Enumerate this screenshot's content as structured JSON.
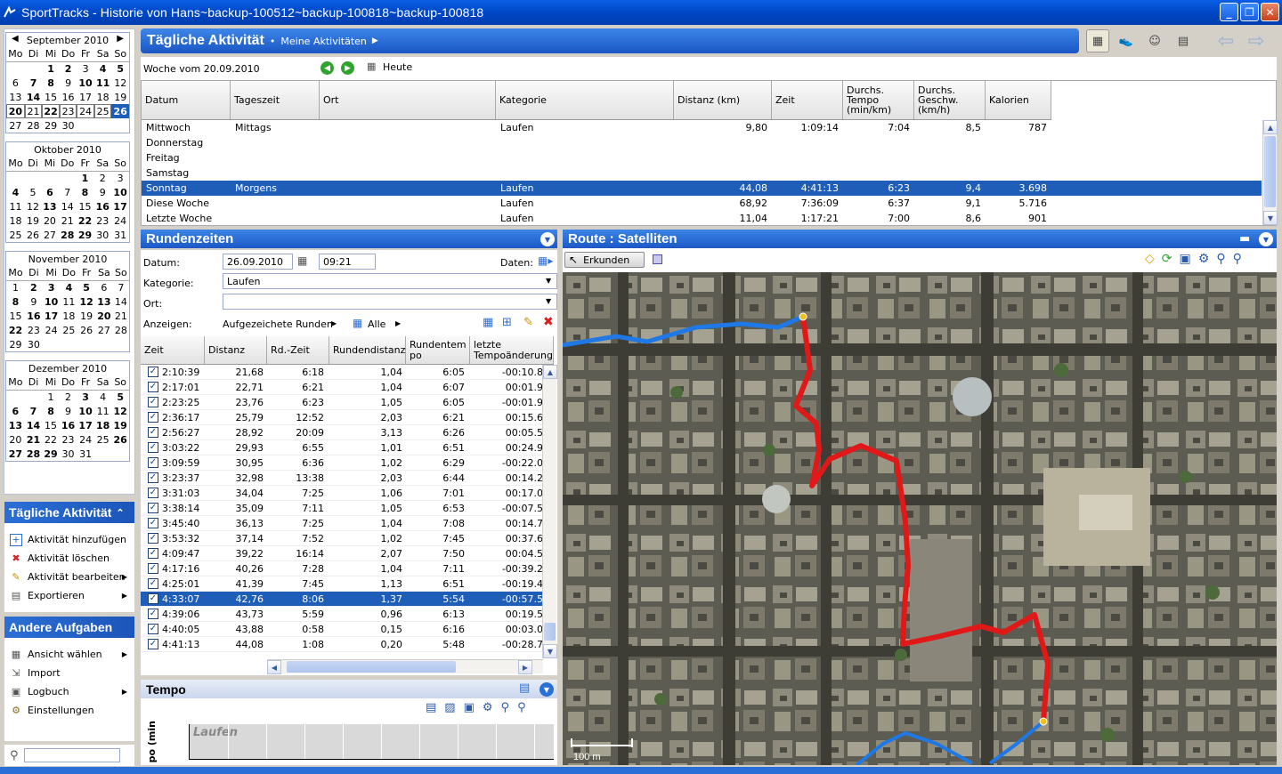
{
  "window": {
    "title": "SportTracks - Historie von Hans~backup-100512~backup-100818~backup-100818"
  },
  "calendar": {
    "weekday_labels": [
      "Mo",
      "Di",
      "Mi",
      "Do",
      "Fr",
      "Sa",
      "So"
    ],
    "months": [
      {
        "name": "September 2010",
        "weeks": [
          [
            "",
            "",
            "1",
            "2",
            "3",
            "4",
            "5"
          ],
          [
            "6",
            "7",
            "8",
            "9",
            "10",
            "11",
            "12"
          ],
          [
            "13",
            "14",
            "15",
            "16",
            "17",
            "18",
            "19"
          ],
          [
            "20",
            "21",
            "22",
            "23",
            "24",
            "25",
            "26"
          ],
          [
            "27",
            "28",
            "29",
            "30",
            "",
            "",
            ""
          ]
        ]
      },
      {
        "name": "Oktober 2010",
        "weeks": [
          [
            "",
            "",
            "",
            "",
            "1",
            "2",
            "3"
          ],
          [
            "4",
            "5",
            "6",
            "7",
            "8",
            "9",
            "10"
          ],
          [
            "11",
            "12",
            "13",
            "14",
            "15",
            "16",
            "17"
          ],
          [
            "18",
            "19",
            "20",
            "21",
            "22",
            "23",
            "24"
          ],
          [
            "25",
            "26",
            "27",
            "28",
            "29",
            "30",
            "31"
          ]
        ]
      },
      {
        "name": "November 2010",
        "weeks": [
          [
            "1",
            "2",
            "3",
            "4",
            "5",
            "6",
            "7"
          ],
          [
            "8",
            "9",
            "10",
            "11",
            "12",
            "13",
            "14"
          ],
          [
            "15",
            "16",
            "17",
            "18",
            "19",
            "20",
            "21"
          ],
          [
            "22",
            "23",
            "24",
            "25",
            "26",
            "27",
            "28"
          ],
          [
            "29",
            "30",
            "",
            "",
            "",
            "",
            ""
          ]
        ]
      },
      {
        "name": "Dezember 2010",
        "weeks": [
          [
            "",
            "",
            "1",
            "2",
            "3",
            "4",
            "5"
          ],
          [
            "6",
            "7",
            "8",
            "9",
            "10",
            "11",
            "12"
          ],
          [
            "13",
            "14",
            "15",
            "16",
            "17",
            "18",
            "19"
          ],
          [
            "20",
            "21",
            "22",
            "23",
            "24",
            "25",
            "26"
          ],
          [
            "27",
            "28",
            "29",
            "30",
            "31",
            "",
            ""
          ]
        ]
      }
    ]
  },
  "tasks_daily": {
    "title": "Tägliche Aktivität",
    "items": [
      {
        "label": "Aktivität hinzufügen",
        "icon": "add-icon"
      },
      {
        "label": "Aktivität löschen",
        "icon": "delete-icon"
      },
      {
        "label": "Aktivität bearbeiten",
        "icon": "pencil-icon"
      },
      {
        "label": "Exportieren",
        "icon": "export-icon"
      }
    ]
  },
  "tasks_other": {
    "title": "Andere Aufgaben",
    "items": [
      {
        "label": "Ansicht wählen",
        "icon": "view-icon"
      },
      {
        "label": "Import",
        "icon": "import-icon"
      },
      {
        "label": "Logbuch",
        "icon": "logbook-icon"
      },
      {
        "label": "Einstellungen",
        "icon": "settings-icon"
      }
    ]
  },
  "header": {
    "title": "Tägliche Aktivität",
    "breadcrumb": "Meine Aktivitäten"
  },
  "week": {
    "label": "Woche vom 20.09.2010",
    "today": "Heute"
  },
  "activity_table": {
    "columns": [
      "Datum",
      "Tageszeit",
      "Ort",
      "Kategorie",
      "Distanz (km)",
      "Zeit",
      "Durchs. Tempo (min/km)",
      "Durchs. Geschw. (km/h)",
      "Kalorien"
    ],
    "rows": [
      [
        "Mittwoch",
        "Mittags",
        "",
        "Laufen",
        "9,80",
        "1:09:14",
        "7:04",
        "8,5",
        "787"
      ],
      [
        "Donnerstag",
        "",
        "",
        "",
        "",
        "",
        "",
        "",
        ""
      ],
      [
        "Freitag",
        "",
        "",
        "",
        "",
        "",
        "",
        "",
        ""
      ],
      [
        "Samstag",
        "",
        "",
        "",
        "",
        "",
        "",
        "",
        ""
      ],
      [
        "Sonntag",
        "Morgens",
        "",
        "Laufen",
        "44,08",
        "4:41:13",
        "6:23",
        "9,4",
        "3.698"
      ],
      [
        "Diese Woche",
        "",
        "",
        "Laufen",
        "68,92",
        "7:36:09",
        "6:37",
        "9,1",
        "5.716"
      ],
      [
        "Letzte Woche",
        "",
        "",
        "Laufen",
        "11,04",
        "1:17:21",
        "7:00",
        "8,6",
        "901"
      ]
    ]
  },
  "laps": {
    "title": "Rundenzeiten",
    "datum_label": "Datum:",
    "datum": "26.09.2010",
    "time": "09:21",
    "daten_label": "Daten:",
    "kategorie_label": "Kategorie:",
    "kategorie": "Laufen",
    "ort_label": "Ort:",
    "ort": "",
    "anzeigen_label": "Anzeigen:",
    "anzeigen_value": "Aufgezeichete Runden",
    "alle": "Alle",
    "columns": [
      "Zeit",
      "Distanz",
      "Rd.-Zeit",
      "Rundendistanz",
      "Rundentem po",
      "letzte Tempoänderung"
    ],
    "rows": [
      [
        "2:10:39",
        "21,68",
        "6:18",
        "1,04",
        "6:05",
        "-00:10.8"
      ],
      [
        "2:17:01",
        "22,71",
        "6:21",
        "1,04",
        "6:07",
        "00:01.9"
      ],
      [
        "2:23:25",
        "23,76",
        "6:23",
        "1,05",
        "6:05",
        "-00:01.9"
      ],
      [
        "2:36:17",
        "25,79",
        "12:52",
        "2,03",
        "6:21",
        "00:15.6"
      ],
      [
        "2:56:27",
        "28,92",
        "20:09",
        "3,13",
        "6:26",
        "00:05.5"
      ],
      [
        "3:03:22",
        "29,93",
        "6:55",
        "1,01",
        "6:51",
        "00:24.9"
      ],
      [
        "3:09:59",
        "30,95",
        "6:36",
        "1,02",
        "6:29",
        "-00:22.0"
      ],
      [
        "3:23:37",
        "32,98",
        "13:38",
        "2,03",
        "6:44",
        "00:14.2"
      ],
      [
        "3:31:03",
        "34,04",
        "7:25",
        "1,06",
        "7:01",
        "00:17.0"
      ],
      [
        "3:38:14",
        "35,09",
        "7:11",
        "1,05",
        "6:53",
        "-00:07.5"
      ],
      [
        "3:45:40",
        "36,13",
        "7:25",
        "1,04",
        "7:08",
        "00:14.7"
      ],
      [
        "3:53:32",
        "37,14",
        "7:52",
        "1,02",
        "7:45",
        "00:37.6"
      ],
      [
        "4:09:47",
        "39,22",
        "16:14",
        "2,07",
        "7:50",
        "00:04.5"
      ],
      [
        "4:17:16",
        "40,26",
        "7:28",
        "1,04",
        "7:11",
        "-00:39.2"
      ],
      [
        "4:25:01",
        "41,39",
        "7:45",
        "1,13",
        "6:51",
        "-00:19.4"
      ],
      [
        "4:33:07",
        "42,76",
        "8:06",
        "1,37",
        "5:54",
        "-00:57.5"
      ],
      [
        "4:39:06",
        "43,73",
        "5:59",
        "0,96",
        "6:13",
        "00:19.5"
      ],
      [
        "4:40:05",
        "43,88",
        "0:58",
        "0,15",
        "6:16",
        "00:03.0"
      ],
      [
        "4:41:13",
        "44,08",
        "1:08",
        "0,20",
        "5:48",
        "-00:28.7"
      ]
    ]
  },
  "tempo": {
    "title": "Tempo",
    "axis_label": "po (min",
    "series_label": "Laufen"
  },
  "route": {
    "title": "Route : Satelliten",
    "explore": "Erkunden",
    "scale": "100 m"
  },
  "colors": {
    "accent": "#1c58c6",
    "selection": "#1f5eb8",
    "route_red": "#e01818",
    "route_blue": "#1e78e6"
  }
}
